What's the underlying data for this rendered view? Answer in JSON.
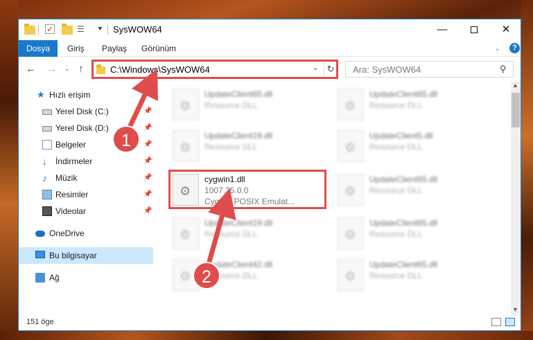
{
  "window": {
    "title": "SysWOW64",
    "minimize_glyph": "—",
    "close_glyph": "✕"
  },
  "ribbon": {
    "tabs": [
      "Dosya",
      "Giriş",
      "Paylaş",
      "Görünüm"
    ],
    "expand_glyph": "⌄",
    "help_label": "?"
  },
  "address": {
    "path": "C:\\Windows\\SysWOW64",
    "dropdown_glyph": "⌄",
    "refresh_glyph": "↻"
  },
  "search": {
    "placeholder": "Ara: SysWOW64",
    "icon": "search-icon"
  },
  "nav": {
    "back_glyph": "←",
    "forward_glyph": "→",
    "recent_glyph": "⌄",
    "up_glyph": "↑"
  },
  "sidebar": {
    "items": [
      {
        "label": "Hızlı erişim",
        "icon": "star-icon",
        "pinned": false
      },
      {
        "label": "Yerel Disk (C:)",
        "icon": "disk-icon",
        "pinned": true
      },
      {
        "label": "Yerel Disk (D:)",
        "icon": "disk-icon",
        "pinned": true
      },
      {
        "label": "Belgeler",
        "icon": "documents-icon",
        "pinned": true
      },
      {
        "label": "İndirmeler",
        "icon": "download-icon",
        "pinned": true
      },
      {
        "label": "Müzik",
        "icon": "music-icon",
        "pinned": true
      },
      {
        "label": "Resimler",
        "icon": "pictures-icon",
        "pinned": true
      },
      {
        "label": "Videolar",
        "icon": "videos-icon",
        "pinned": true
      },
      {
        "label": "OneDrive",
        "icon": "onedrive-icon",
        "pinned": false
      },
      {
        "label": "Bu bilgisayar",
        "icon": "computer-icon",
        "pinned": false,
        "selected": true
      },
      {
        "label": "Ağ",
        "icon": "network-icon",
        "pinned": false
      }
    ],
    "pin_glyph": "📌"
  },
  "files": [
    {
      "name": "UpdateClient65.dll",
      "line2": "Resource DLL",
      "line3": "",
      "blurred": true
    },
    {
      "name": "UpdateClient65.dll",
      "line2": "Resource DLL",
      "line3": "",
      "blurred": true
    },
    {
      "name": "UpdateClient19.dll",
      "line2": "Resource DLL",
      "line3": "",
      "blurred": true
    },
    {
      "name": "UpdateClient5.dll",
      "line2": "Resource DLL",
      "line3": "",
      "blurred": true
    },
    {
      "name": "cygwin1.dll",
      "line2": "1007.25.0.0",
      "line3": "Cygwin POSIX Emulat...",
      "blurred": false
    },
    {
      "name": "UpdateClient65.dll",
      "line2": "Resource DLL",
      "line3": "",
      "blurred": true
    },
    {
      "name": "UpdateClient19.dll",
      "line2": "Resource DLL",
      "line3": "",
      "blurred": true
    },
    {
      "name": "UpdateClient65.dll",
      "line2": "Resource DLL",
      "line3": "",
      "blurred": true
    },
    {
      "name": "UpdateClient42.dll",
      "line2": "Resource DLL",
      "line3": "",
      "blurred": true
    },
    {
      "name": "UpdateClient65.dll",
      "line2": "Resource DLL",
      "line3": "",
      "blurred": true
    }
  ],
  "status": {
    "item_count": "151 öge"
  },
  "callouts": {
    "step1": "1",
    "step2": "2"
  },
  "colors": {
    "accent": "#1979ca",
    "highlight": "#e04b4b",
    "selection": "#cce8ff"
  }
}
